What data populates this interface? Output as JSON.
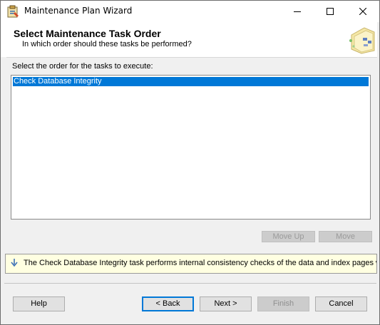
{
  "window": {
    "title": "Maintenance Plan Wizard",
    "icon": "wizard-app-icon"
  },
  "header": {
    "title": "Select Maintenance Task Order",
    "subtitle": "In which order should these tasks be performed?",
    "art_icon": "folder-art-icon"
  },
  "task_list": {
    "label": "Select the order for the tasks to execute:",
    "items": [
      {
        "label": "Check Database Integrity",
        "selected": true
      }
    ]
  },
  "move_buttons": {
    "up_label": "Move Up",
    "down_label": "Move"
  },
  "info_bar": {
    "icon": "info-arrow-icon",
    "text": "The Check Database Integrity task performs internal consistency checks of the data and index pages with"
  },
  "footer_buttons": {
    "help": "Help",
    "back": "< Back",
    "next": "Next >",
    "finish": "Finish",
    "cancel": "Cancel"
  },
  "colors": {
    "selection": "#0078d7",
    "info_background": "#ffffe1",
    "dialog_background": "#f0f0f0"
  }
}
